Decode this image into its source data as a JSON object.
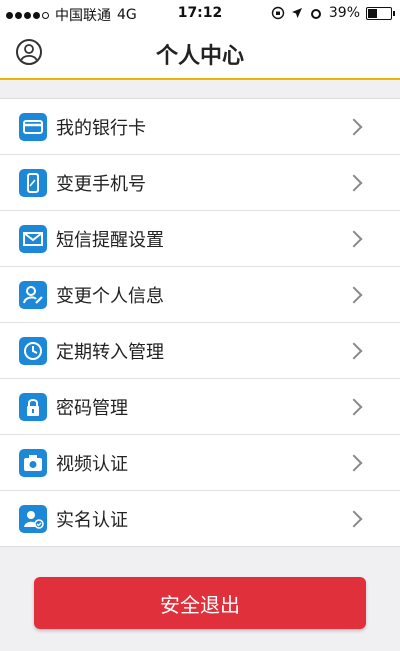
{
  "status_bar": {
    "carrier": "中国联通",
    "network": "4G",
    "time": "17:12",
    "battery_percent": "39%",
    "battery_level": 0.39
  },
  "nav": {
    "title": "个人中心",
    "left_icon": "user-avatar-icon"
  },
  "menu": {
    "items": [
      {
        "label": "我的银行卡",
        "icon": "bank-card-icon"
      },
      {
        "label": "变更手机号",
        "icon": "phone-icon"
      },
      {
        "label": "短信提醒设置",
        "icon": "envelope-icon"
      },
      {
        "label": "变更个人信息",
        "icon": "user-edit-icon"
      },
      {
        "label": "定期转入管理",
        "icon": "clock-icon"
      },
      {
        "label": "密码管理",
        "icon": "lock-icon"
      },
      {
        "label": "视频认证",
        "icon": "camera-icon"
      },
      {
        "label": "实名认证",
        "icon": "id-badge-icon"
      }
    ]
  },
  "logout_label": "安全退出",
  "colors": {
    "accent_blue": "#1e88d8",
    "logout_red": "#e0303b",
    "nav_underline": "#f0b400"
  }
}
